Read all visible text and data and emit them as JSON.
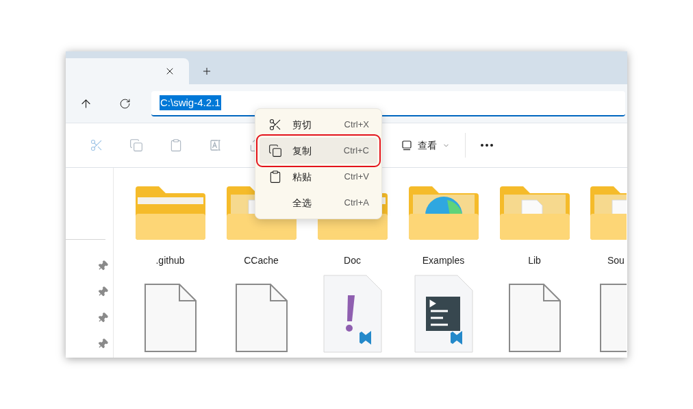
{
  "address": {
    "value": "C:\\swig-4.2.1",
    "selected": true
  },
  "toolbar": {
    "buttons": [
      {
        "kind": "cut",
        "disabled": true
      },
      {
        "kind": "copy",
        "disabled": true
      },
      {
        "kind": "paste",
        "disabled": true
      },
      {
        "kind": "rename",
        "disabled": true
      },
      {
        "kind": "share",
        "disabled": true
      }
    ],
    "view": {
      "label": "查看"
    }
  },
  "folders": [
    {
      "name": ".github",
      "kind": "plain"
    },
    {
      "name": "CCache",
      "kind": "document"
    },
    {
      "name": "Doc",
      "kind": "plain"
    },
    {
      "name": "Examples",
      "kind": "edge"
    },
    {
      "name": "Lib",
      "kind": "document"
    },
    {
      "name": "Sou",
      "kind": "document"
    }
  ],
  "files": [
    {
      "kind": "blank"
    },
    {
      "kind": "blank"
    },
    {
      "kind": "warning"
    },
    {
      "kind": "terminal"
    },
    {
      "kind": "blank"
    },
    {
      "kind": "blank"
    }
  ],
  "context_menu": {
    "items": [
      {
        "label": "剪切",
        "shortcut": "Ctrl+X",
        "kind": "cut",
        "selected": false
      },
      {
        "label": "复制",
        "shortcut": "Ctrl+C",
        "kind": "copy",
        "selected": true
      },
      {
        "label": "粘贴",
        "shortcut": "Ctrl+V",
        "kind": "paste",
        "selected": false
      },
      {
        "label": "全选",
        "shortcut": "Ctrl+A",
        "kind": "none",
        "selected": false
      }
    ]
  }
}
